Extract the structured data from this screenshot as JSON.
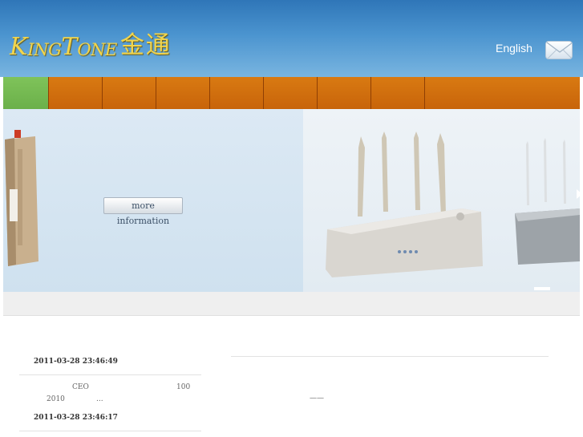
{
  "header": {
    "logo_text_k": "K",
    "logo_text_ing": "ING",
    "logo_text_t": "T",
    "logo_text_one": "ONE",
    "logo_text_cn": "金通",
    "language_label": "English"
  },
  "nav": {
    "tabs": [
      {
        "label": ""
      },
      {
        "label": ""
      },
      {
        "label": ""
      },
      {
        "label": ""
      },
      {
        "label": ""
      },
      {
        "label": ""
      },
      {
        "label": ""
      },
      {
        "label": ""
      },
      {
        "label": ""
      }
    ]
  },
  "banner": {
    "button_label": "more information"
  },
  "news": {
    "items": [
      {
        "date": "2011-03-28 23:46:49",
        "line1_a": "CEO",
        "line1_b": "100",
        "line2_a": "2010",
        "line2_b": "..."
      },
      {
        "date": "2011-03-28 23:46:17"
      }
    ],
    "right_dash": "——"
  },
  "colors": {
    "header_blue": "#4b94cf",
    "nav_orange": "#d97a12",
    "nav_active_green": "#7fc35a",
    "logo_gold": "#f1d54e"
  },
  "icons": {
    "mail": "envelope-icon",
    "arrow": "chevron-right-icon"
  }
}
